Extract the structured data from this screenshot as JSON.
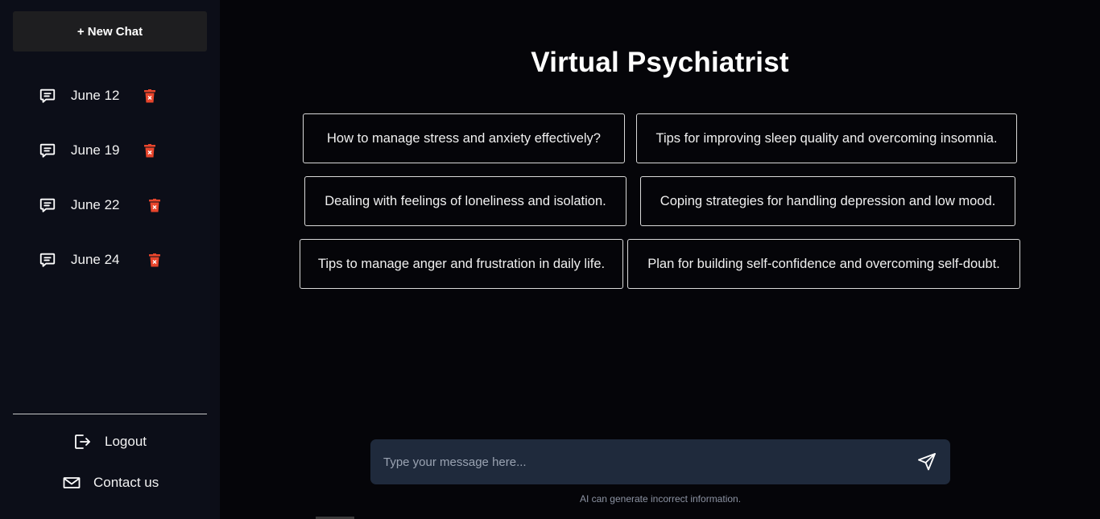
{
  "sidebar": {
    "new_chat_label": "+ New Chat",
    "chats": [
      {
        "label": "June 12"
      },
      {
        "label": "June 19"
      },
      {
        "label": "June 22"
      },
      {
        "label": "June 24"
      }
    ],
    "logout_label": "Logout",
    "contact_label": "Contact us"
  },
  "main": {
    "title": "Virtual Psychiatrist",
    "suggestions": [
      "How to manage stress and anxiety effectively?",
      "Tips for improving sleep quality and overcoming insomnia.",
      "Dealing with feelings of loneliness and isolation.",
      "Coping strategies for handling depression and low mood.",
      "Tips to manage anger and frustration in daily life.",
      "Plan for building self-confidence and overcoming self-doubt."
    ],
    "input": {
      "placeholder": "Type your message here...",
      "value": ""
    },
    "disclaimer": "AI can generate incorrect information."
  },
  "colors": {
    "background": "#050509",
    "sidebar": "#0c0e18",
    "new_chat_button": "#1e1e20",
    "input_bar": "#1f2a3c",
    "trash_icon": "#e8452c"
  },
  "icons": {
    "chat": "message-square-icon",
    "delete": "trash-icon",
    "logout": "logout-icon",
    "contact": "mail-icon",
    "send": "send-icon"
  }
}
